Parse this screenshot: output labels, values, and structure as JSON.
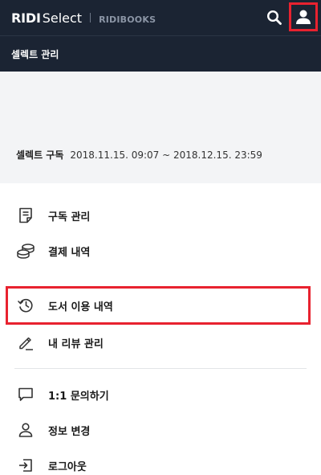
{
  "header": {
    "brand_main": "RIDI",
    "brand_sub": "Select",
    "brand_secondary": "RIDIBOOKS",
    "search_icon": "search-icon",
    "profile_icon": "user-icon"
  },
  "subheader": {
    "title": "셀렉트 관리"
  },
  "subscription": {
    "label": "셀렉트 구독",
    "period": "2018.11.15. 09:07 ~ 2018.12.15. 23:59"
  },
  "menu": {
    "group1": [
      {
        "label": "구독 관리",
        "icon": "document-icon"
      },
      {
        "label": "결제 내역",
        "icon": "coins-icon"
      }
    ],
    "group2": [
      {
        "label": "도서 이용 내역",
        "icon": "history-icon"
      },
      {
        "label": "내 리뷰 관리",
        "icon": "pencil-icon"
      }
    ],
    "group3": [
      {
        "label": "1:1 문의하기",
        "icon": "chat-icon"
      },
      {
        "label": "정보 변경",
        "icon": "user-icon"
      },
      {
        "label": "로그아웃",
        "icon": "logout-icon"
      }
    ]
  },
  "colors": {
    "header_bg": "#1b2433",
    "highlight": "#e8222f",
    "panel_bg": "#f3f4f6"
  }
}
